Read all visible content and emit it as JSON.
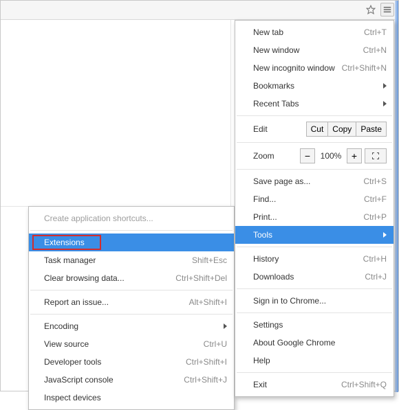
{
  "toolbar": {
    "star_title": "Bookmark this page",
    "menu_title": "Customize and control Google Chrome"
  },
  "main_menu": {
    "new_tab": {
      "label": "New tab",
      "shortcut": "Ctrl+T"
    },
    "new_window": {
      "label": "New window",
      "shortcut": "Ctrl+N"
    },
    "new_incognito": {
      "label": "New incognito window",
      "shortcut": "Ctrl+Shift+N"
    },
    "bookmarks": {
      "label": "Bookmarks"
    },
    "recent_tabs": {
      "label": "Recent Tabs"
    },
    "edit": {
      "label": "Edit",
      "cut": "Cut",
      "copy": "Copy",
      "paste": "Paste"
    },
    "zoom": {
      "label": "Zoom",
      "minus": "−",
      "value": "100%",
      "plus": "+",
      "fullscreen_title": "Full screen"
    },
    "save_page": {
      "label": "Save page as...",
      "shortcut": "Ctrl+S"
    },
    "find": {
      "label": "Find...",
      "shortcut": "Ctrl+F"
    },
    "print": {
      "label": "Print...",
      "shortcut": "Ctrl+P"
    },
    "tools": {
      "label": "Tools"
    },
    "history": {
      "label": "History",
      "shortcut": "Ctrl+H"
    },
    "downloads": {
      "label": "Downloads",
      "shortcut": "Ctrl+J"
    },
    "signin": {
      "label": "Sign in to Chrome..."
    },
    "settings": {
      "label": "Settings"
    },
    "about": {
      "label": "About Google Chrome"
    },
    "help": {
      "label": "Help"
    },
    "exit": {
      "label": "Exit",
      "shortcut": "Ctrl+Shift+Q"
    }
  },
  "tools_submenu": {
    "create_shortcuts": {
      "label": "Create application shortcuts..."
    },
    "extensions": {
      "label": "Extensions"
    },
    "task_manager": {
      "label": "Task manager",
      "shortcut": "Shift+Esc"
    },
    "clear_data": {
      "label": "Clear browsing data...",
      "shortcut": "Ctrl+Shift+Del"
    },
    "report_issue": {
      "label": "Report an issue...",
      "shortcut": "Alt+Shift+I"
    },
    "encoding": {
      "label": "Encoding"
    },
    "view_source": {
      "label": "View source",
      "shortcut": "Ctrl+U"
    },
    "developer_tools": {
      "label": "Developer tools",
      "shortcut": "Ctrl+Shift+I"
    },
    "js_console": {
      "label": "JavaScript console",
      "shortcut": "Ctrl+Shift+J"
    },
    "inspect_devices": {
      "label": "Inspect devices"
    }
  },
  "colors": {
    "selection": "#3a8ee6",
    "highlight_border": "#d42c2c"
  }
}
